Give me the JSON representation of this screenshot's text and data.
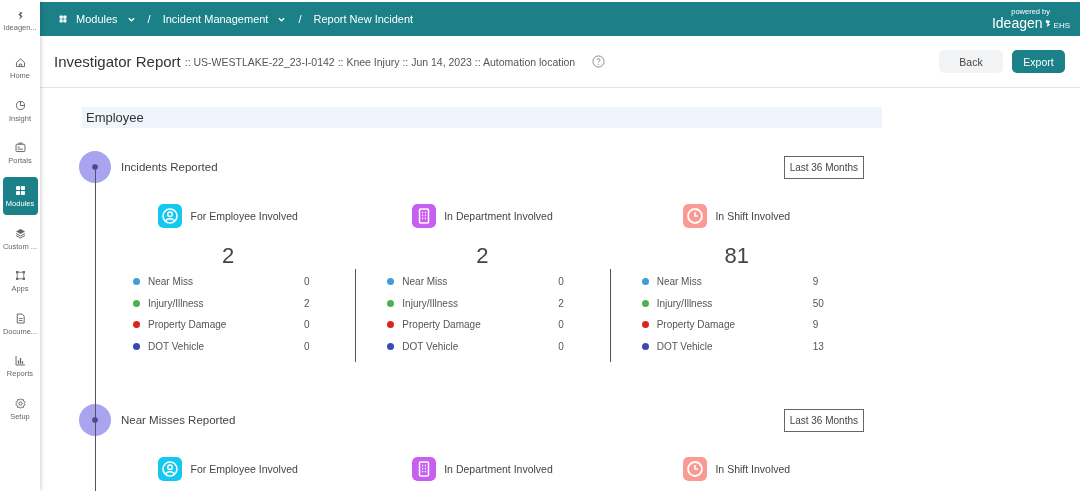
{
  "sidebar": {
    "logo_label": "Ideagen...",
    "items": [
      {
        "label": "Home",
        "kind": "home",
        "selected": false
      },
      {
        "label": "Insight",
        "kind": "pie",
        "selected": false
      },
      {
        "label": "Portals",
        "kind": "portal",
        "selected": false
      },
      {
        "label": "Modules",
        "kind": "grid",
        "selected": true
      },
      {
        "label": "Custom ...",
        "kind": "layers",
        "selected": false
      },
      {
        "label": "Apps",
        "kind": "apps",
        "selected": false
      },
      {
        "label": "Docume...",
        "kind": "document",
        "selected": false
      },
      {
        "label": "Reports",
        "kind": "bars",
        "selected": false
      },
      {
        "label": "Setup",
        "kind": "gear",
        "selected": false
      }
    ]
  },
  "breadcrumb": [
    {
      "label": "Modules",
      "dropdown": true
    },
    {
      "separator": "/",
      "label": "Incident Management",
      "dropdown": true
    },
    {
      "separator": "/",
      "label": "Report New Incident",
      "dropdown": false
    }
  ],
  "brand": {
    "tagline": "powered by",
    "name": "Ideagen",
    "suffix": "EHS"
  },
  "page": {
    "title": "Investigator Report",
    "subtitle": ":: US-WESTLAKE-22_23-I-0142 :: Knee Injury :: Jun 14, 2023 :: Automation location",
    "buttons": [
      {
        "label": "Back",
        "kind": "secondary"
      },
      {
        "label": "Export",
        "kind": "primary"
      }
    ]
  },
  "group_title": "Employee",
  "sections": [
    {
      "title": "Incidents Reported",
      "period": "Last 36 Months",
      "cards": [
        {
          "label": "For Employee Involved",
          "kind": "person",
          "color": "#14c8f0",
          "total": "2",
          "rows": [
            {
              "label": "Near Miss",
              "color": "#3d9dd6",
              "value": "0"
            },
            {
              "label": "Injury/Illness",
              "color": "#4cb050",
              "value": "2"
            },
            {
              "label": "Property Damage",
              "color": "#d9261c",
              "value": "0"
            },
            {
              "label": "DOT Vehicle",
              "color": "#3a47b8",
              "value": "0"
            }
          ]
        },
        {
          "label": "In Department Involved",
          "kind": "building",
          "color": "#c85ff0",
          "total": "2",
          "rows": [
            {
              "label": "Near Miss",
              "color": "#3d9dd6",
              "value": "0"
            },
            {
              "label": "Injury/Illness",
              "color": "#4cb050",
              "value": "2"
            },
            {
              "label": "Property Damage",
              "color": "#d9261c",
              "value": "0"
            },
            {
              "label": "DOT Vehicle",
              "color": "#3a47b8",
              "value": "0"
            }
          ]
        },
        {
          "label": "In Shift Involved",
          "kind": "clock",
          "color": "#f99a94",
          "total": "81",
          "rows": [
            {
              "label": "Near Miss",
              "color": "#3d9dd6",
              "value": "9"
            },
            {
              "label": "Injury/Illness",
              "color": "#4cb050",
              "value": "50"
            },
            {
              "label": "Property Damage",
              "color": "#d9261c",
              "value": "9"
            },
            {
              "label": "DOT Vehicle",
              "color": "#3a47b8",
              "value": "13"
            }
          ]
        }
      ]
    },
    {
      "title": "Near Misses Reported",
      "period": "Last 36 Months",
      "cards": [
        {
          "label": "For Employee Involved",
          "kind": "person",
          "color": "#14c8f0"
        },
        {
          "label": "In Department Involved",
          "kind": "building",
          "color": "#c85ff0"
        },
        {
          "label": "In Shift Involved",
          "kind": "clock",
          "color": "#f99a94"
        }
      ]
    }
  ]
}
